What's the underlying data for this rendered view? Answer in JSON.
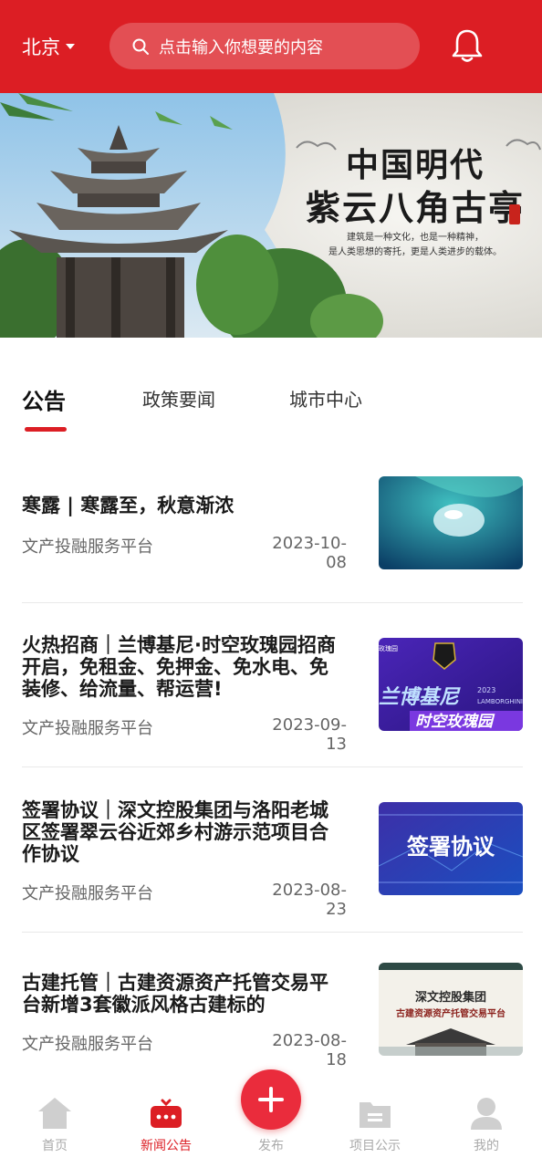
{
  "header": {
    "city": "北京",
    "search_placeholder": "点击输入你想要的内容",
    "accent_color": "#dc1e24"
  },
  "banner": {
    "title_line1": "中国明代",
    "title_line2": "紫云八角古亭",
    "subtitle_line1": "建筑是一种文化，也是一种精神，",
    "subtitle_line2": "是人类思想的寄托，更是人类进步的载体。"
  },
  "tabs": [
    {
      "label": "公告",
      "active": true
    },
    {
      "label": "政策要闻",
      "active": false
    },
    {
      "label": "城市中心",
      "active": false
    }
  ],
  "news": [
    {
      "title": "寒露 | 寒露至，秋意渐浓",
      "source": "文产投融服务平台",
      "date": "2023-10-08",
      "thumb": "water-drop-image"
    },
    {
      "title": "火热招商｜兰博基尼·时空玫瑰园招商开启，免租金、免押金、免水电、免装修、给流量、帮运营!",
      "source": "文产投融服务平台",
      "date": "2023-09-13",
      "thumb": "lamborghini-banner-image",
      "thumb_text_1": "兰博基尼",
      "thumb_text_2": "时空玫瑰园",
      "thumb_text_3": "2023",
      "thumb_text_4": "LAMBORGHINI",
      "thumb_text_5": "玫瑰园"
    },
    {
      "title": "签署协议｜深文控股集团与洛阳老城区签署翠云谷近郊乡村游示范项目合作协议",
      "source": "文产投融服务平台",
      "date": "2023-08-23",
      "thumb": "agreement-image",
      "thumb_text": "签署协议"
    },
    {
      "title": "古建托管｜古建资源资产托管交易平台新增3套徽派风格古建标的",
      "source": "文产投融服务平台",
      "date": "2023-08-18",
      "thumb": "ancient-architecture-image",
      "thumb_text_1": "深文控股集团",
      "thumb_text_2": "古建资源资产托管交易平台"
    }
  ],
  "bottom_nav": [
    {
      "label": "首页",
      "icon": "home-icon",
      "active": false
    },
    {
      "label": "新闻公告",
      "icon": "news-icon",
      "active": true
    },
    {
      "label": "发布",
      "icon": "plus-icon",
      "active": false
    },
    {
      "label": "项目公示",
      "icon": "folder-icon",
      "active": false
    },
    {
      "label": "我的",
      "icon": "user-icon",
      "active": false
    }
  ]
}
